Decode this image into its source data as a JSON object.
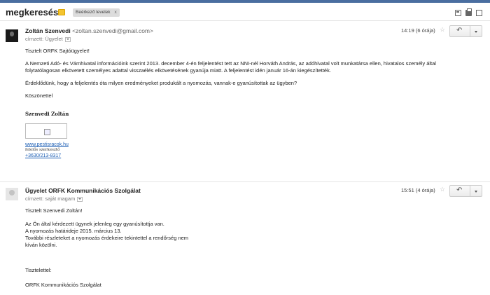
{
  "header": {
    "subject": "megkeresés",
    "label": "Beérkező levelek",
    "label_close": "x"
  },
  "messages": [
    {
      "sender_name": "Zoltán Szenvedi",
      "sender_email": "<zoltan.szenvedi@gmail.com>",
      "recipient": "címzett: Ügyelet",
      "time": "14:19 (6 órája)",
      "star": "☆",
      "paragraphs": [
        "Tisztelt ORFK Sajtóügyelet!",
        "A Nemzeti Adó- és Vámhivatal információink szerint 2013. december 4-én feljelentést tett az NNI-nél Horváth András, az adóhivatal volt munkatársa ellen, hivatalos személy által folytatólagosan elkövetett személyes adattal visszaélés elkövetésének gyanúja miatt. A feljelentést idén január 16-án kiegészítették.",
        "Érdeklődünk, hogy a feljelentés óta milyen eredményeket produkált a nyomozás, vannak-e gyanúsítottak az ügyben?",
        "Köszönettel"
      ],
      "signature": {
        "name": "Szenvedi Zoltán",
        "website": "www.pestisracok.hu",
        "role": "felelős szerkesztő",
        "phone": "+3630/213-8317"
      }
    },
    {
      "sender_name": "Ügyelet ORFK Kommunikációs Szolgálat",
      "recipient": "címzett: saját magam",
      "time": "15:51 (4 órája)",
      "star": "☆",
      "greeting": "Tisztelt Szenvedi Zoltán!",
      "lines": [
        "Az Ön által kérdezett ügynek jelenleg egy gyanúsítottja van.",
        "A nyomozás határideje 2015. március 13.",
        "További részleteket a nyomozás érdekeire tekintettel a rendőrség nem",
        "kíván közölni."
      ],
      "closing": "Tisztelettel:",
      "signoff": "ORFK Kommunikációs Szolgálat"
    }
  ]
}
